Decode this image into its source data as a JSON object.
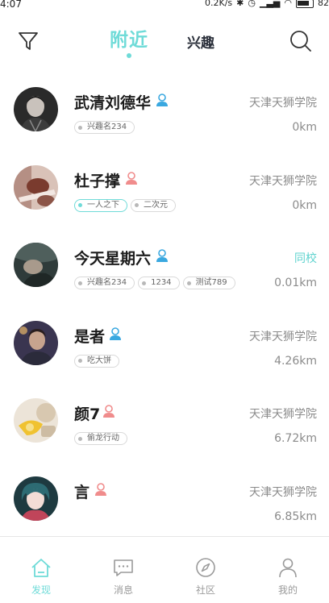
{
  "status_bar": {
    "time": "4:07",
    "network_speed": "0.2K/s",
    "battery_level": "82"
  },
  "header": {
    "tabs": [
      {
        "label": "附近",
        "active": true
      },
      {
        "label": "兴趣",
        "active": false
      }
    ],
    "filter_icon": "filter-icon",
    "search_icon": "search-icon"
  },
  "colors": {
    "accent": "#6fdbd8",
    "male_icon": "#3aa8e0",
    "female_icon": "#f08c8c",
    "text_secondary": "#8b8b8b"
  },
  "users": [
    {
      "name": "武清刘德华",
      "gender": "male",
      "school": "天津天狮学院",
      "school_highlight": false,
      "distance": "0km",
      "tags": [
        {
          "label": "兴趣名234",
          "active": false
        }
      ]
    },
    {
      "name": "杜子撑",
      "gender": "female",
      "school": "天津天狮学院",
      "school_highlight": false,
      "distance": "0km",
      "tags": [
        {
          "label": "一人之下",
          "active": true
        },
        {
          "label": "二次元",
          "active": false
        }
      ]
    },
    {
      "name": "今天星期六",
      "gender": "male",
      "school": "同校",
      "school_highlight": true,
      "distance": "0.01km",
      "tags": [
        {
          "label": "兴趣名234",
          "active": false
        },
        {
          "label": "1234",
          "active": false
        },
        {
          "label": "测试789",
          "active": false
        }
      ]
    },
    {
      "name": "是者",
      "gender": "male",
      "school": "天津天狮学院",
      "school_highlight": false,
      "distance": "4.26km",
      "tags": [
        {
          "label": "吃大饼",
          "active": false
        }
      ]
    },
    {
      "name": "颜7",
      "gender": "female",
      "school": "天津天狮学院",
      "school_highlight": false,
      "distance": "6.72km",
      "tags": [
        {
          "label": "偷龙行动",
          "active": false
        }
      ]
    },
    {
      "name": "言",
      "gender": "female",
      "school": "天津天狮学院",
      "school_highlight": false,
      "distance": "6.85km",
      "tags": []
    }
  ],
  "bottom_nav": [
    {
      "label": "发现",
      "icon": "home-icon",
      "active": true
    },
    {
      "label": "消息",
      "icon": "message-icon",
      "active": false
    },
    {
      "label": "社区",
      "icon": "compass-icon",
      "active": false
    },
    {
      "label": "我的",
      "icon": "profile-icon",
      "active": false
    }
  ]
}
